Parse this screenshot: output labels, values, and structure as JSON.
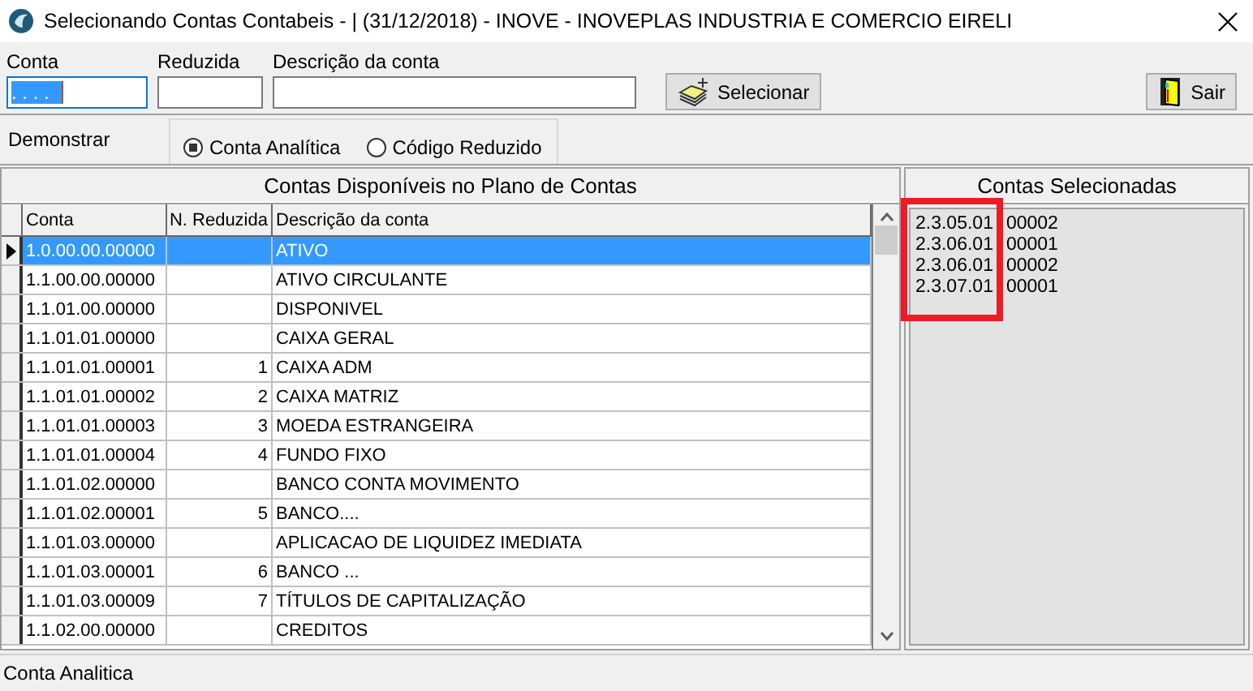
{
  "window": {
    "title": "Selecionando Contas Contabeis - | (31/12/2018) - INOVE - INOVEPLAS INDUSTRIA E COMERCIO EIRELI"
  },
  "fields": [
    {
      "label": "Conta",
      "value": ". . . .",
      "highlighted": true
    },
    {
      "label": "Reduzida"
    },
    {
      "label": "Descrição da conta"
    }
  ],
  "buttons": [
    {
      "label": "Selecionar",
      "kind": "select"
    },
    {
      "label": "Sair",
      "kind": "exit"
    }
  ],
  "demonstrar": {
    "label": "Demonstrar",
    "options": [
      {
        "label": "Conta Analítica",
        "selected": true
      },
      {
        "label": "Código Reduzido",
        "selected": false
      }
    ]
  },
  "available": {
    "title": "Contas Disponíveis no Plano de Contas",
    "columns": [
      "Conta",
      "N. Reduzida",
      "Descrição da conta"
    ],
    "rows": [
      {
        "conta": "1.0.00.00.00000",
        "descricao": "ATIVO",
        "selected": true
      },
      {
        "conta": "1.1.00.00.00000",
        "descricao": "ATIVO CIRCULANTE",
        "selected": false
      },
      {
        "conta": "1.1.01.00.00000",
        "descricao": "DISPONIVEL",
        "selected": false
      },
      {
        "conta": "1.1.01.01.00000",
        "descricao": "CAIXA GERAL",
        "selected": false
      },
      {
        "conta": "1.1.01.01.00001",
        "reduzida": "1",
        "descricao": "CAIXA ADM",
        "selected": false
      },
      {
        "conta": "1.1.01.01.00002",
        "reduzida": "2",
        "descricao": "CAIXA MATRIZ",
        "selected": false
      },
      {
        "conta": "1.1.01.01.00003",
        "reduzida": "3",
        "descricao": "MOEDA ESTRANGEIRA",
        "selected": false
      },
      {
        "conta": "1.1.01.01.00004",
        "reduzida": "4",
        "descricao": "FUNDO FIXO",
        "selected": false
      },
      {
        "conta": "1.1.01.02.00000",
        "descricao": "BANCO CONTA MOVIMENTO",
        "selected": false
      },
      {
        "conta": "1.1.01.02.00001",
        "reduzida": "5",
        "descricao": "BANCO....",
        "selected": false
      },
      {
        "conta": "1.1.01.03.00000",
        "descricao": "APLICACAO DE LIQUIDEZ IMEDIATA",
        "selected": false
      },
      {
        "conta": "1.1.01.03.00001",
        "reduzida": "6",
        "descricao": "BANCO ...",
        "selected": false
      },
      {
        "conta": "1.1.01.03.00009",
        "reduzida": "7",
        "descricao": "TÍTULOS DE CAPITALIZAÇÃO",
        "selected": false
      },
      {
        "conta": "1.1.02.00.00000",
        "descricao": "CREDITOS",
        "selected": false
      }
    ]
  },
  "selected_accounts": {
    "title": "Contas Selecionadas",
    "items": [
      {
        "code": "2.3.05.01",
        "rest": "00002"
      },
      {
        "code": "2.3.06.01",
        "rest": "00001"
      },
      {
        "code": "2.3.06.01",
        "rest": "00002"
      },
      {
        "code": "2.3.07.01",
        "rest": "00001"
      }
    ]
  },
  "status_bar": "Conta Analitica"
}
